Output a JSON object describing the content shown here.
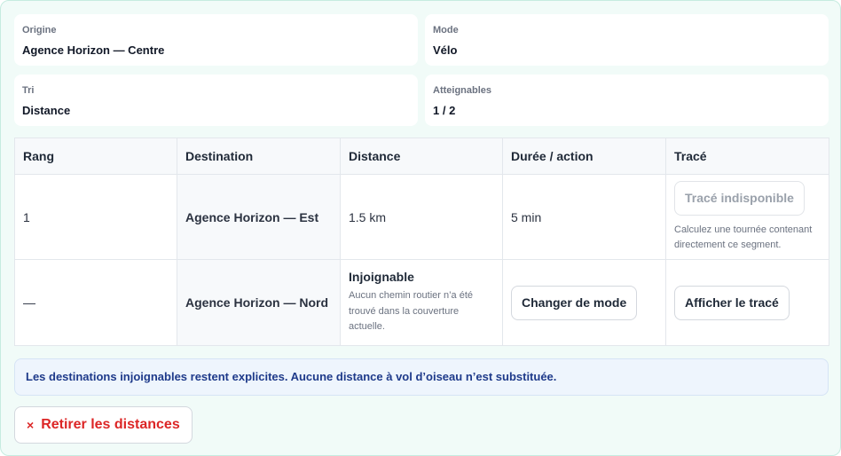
{
  "summary": {
    "origin_label": "Origine",
    "origin_value": "Agence Horizon — Centre",
    "mode_label": "Mode",
    "mode_value": "Vélo",
    "sort_label": "Tri",
    "sort_value": "Distance",
    "reachable_label": "Atteignables",
    "reachable_value": "1 / 2"
  },
  "table": {
    "headers": [
      "Rang",
      "Destination",
      "Distance",
      "Durée / action",
      "Tracé"
    ],
    "rows": [
      {
        "rank": "1",
        "destination": "Agence Horizon — Est",
        "distance": "1.5 km",
        "duration": "5 min",
        "trace_button": "Tracé indisponible",
        "trace_hint": "Calculez une tournée contenant directement ce segment."
      },
      {
        "rank": "—",
        "destination": "Agence Horizon — Nord",
        "distance_status": "Injoignable",
        "distance_note": "Aucun chemin routier n’a été trouvé dans la couverture actuelle.",
        "action_button": "Changer de mode",
        "trace_button": "Afficher le tracé"
      }
    ]
  },
  "notice": "Les destinations injoignables restent explicites. Aucune distance à vol d’oiseau n’est substituée.",
  "remove_button": {
    "icon": "×",
    "label": "Retirer les distances"
  },
  "colors": {
    "panel_bg": "#f1fbf8",
    "notice_text": "#1e3a8a",
    "danger": "#dc2626"
  }
}
